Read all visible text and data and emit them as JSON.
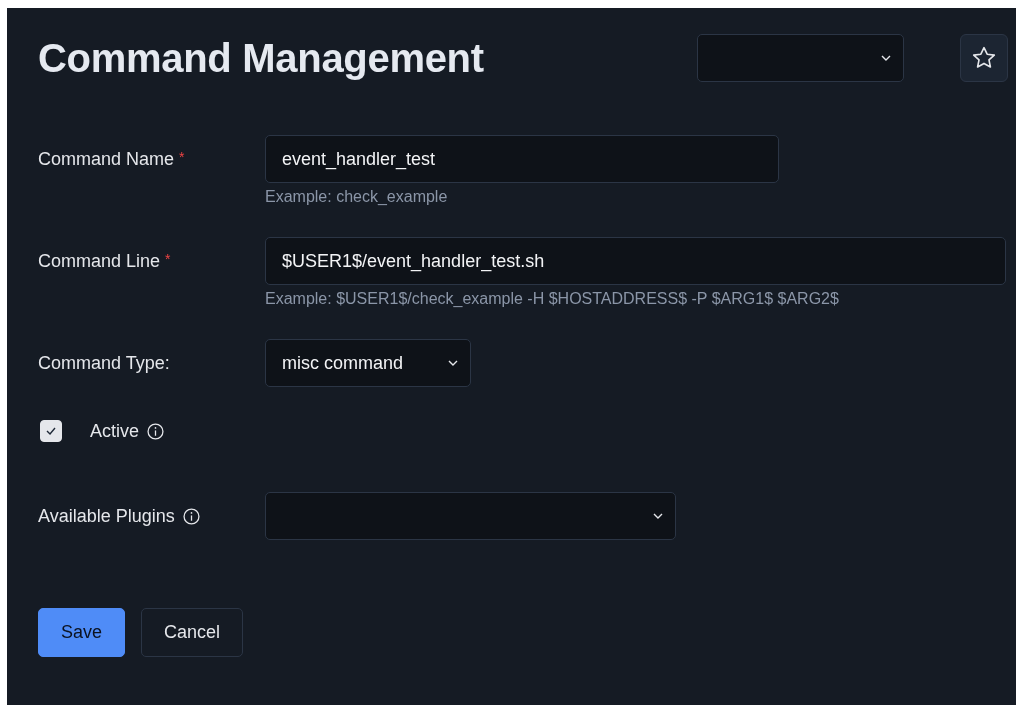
{
  "header": {
    "title": "Command Management",
    "favorite": {
      "starred": false
    }
  },
  "fields": [
    {
      "kind": "text",
      "label": "Command Name",
      "required_mark": "*",
      "value": "event_handler_test",
      "hint": "Example: check_example"
    },
    {
      "kind": "text",
      "label": "Command Line",
      "required_mark": "*",
      "value": "$USER1$/event_handler_test.sh",
      "hint": "Example: $USER1$/check_example -H $HOSTADDRESS$ -P $ARG1$ $ARG2$"
    },
    {
      "kind": "select",
      "label": "Command Type:",
      "value": "misc command"
    },
    {
      "kind": "checkbox",
      "label": "Active",
      "checked": true,
      "info": true
    },
    {
      "kind": "select",
      "label": "Available Plugins",
      "info": true
    }
  ],
  "buttons": [
    {
      "label": "Save",
      "primary": true
    },
    {
      "label": "Cancel",
      "primary": false
    }
  ]
}
